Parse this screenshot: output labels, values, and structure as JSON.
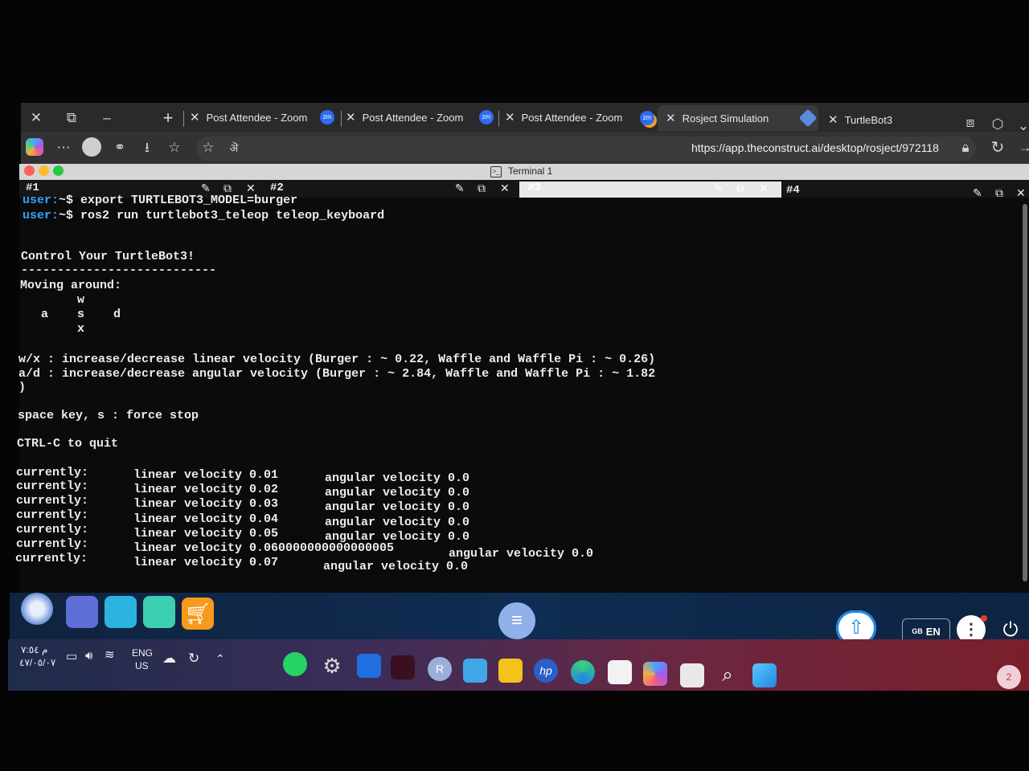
{
  "browser": {
    "tabs": [
      {
        "label": "Post Attendee - Zoom",
        "app_icon": "zm"
      },
      {
        "label": "Post Attendee - Zoom",
        "app_icon": "zm"
      },
      {
        "label": "Post Attendee - Zoom",
        "app_icon": "zm"
      },
      {
        "label": "Rosject Simulation",
        "app_icon": "rosject-icon"
      },
      {
        "label": "TurtleBot3",
        "app_icon": "none"
      }
    ],
    "url": "https://app.theconstruct.ai/desktop/rosject/972118",
    "address_icon_text": "ऄ"
  },
  "terminal": {
    "window_title": "Terminal 1",
    "panes": [
      "#1",
      "#2",
      "#3",
      "#4"
    ],
    "lines": [
      {
        "user": "user:",
        "path": "~$",
        "cmd": " export TURTLEBOT3_MODEL=burger"
      },
      {
        "user": "user:",
        "path": "~$",
        "cmd": " ros2 run turtlebot3_teleop teleop_keyboard"
      }
    ],
    "output": {
      "heading": "Control Your TurtleBot3!",
      "rule": "---------------------------",
      "moving": "Moving around:",
      "key_w": "w",
      "key_row": "a    s    d",
      "key_x": "x",
      "help1": "w/x : increase/decrease linear velocity (Burger : ~ 0.22, Waffle and Waffle Pi : ~ 0.26)",
      "help2": "a/d : increase/decrease angular velocity (Burger : ~ 2.84, Waffle and Waffle Pi : ~ 1.82",
      "help2b": ")",
      "stop": "space key, s : force stop",
      "quit": "CTRL-C to quit"
    },
    "status_rows": [
      {
        "label": "currently:",
        "linear": "linear velocity 0.01",
        "angular": "angular velocity 0.0"
      },
      {
        "label": "currently:",
        "linear": "linear velocity 0.02",
        "angular": "angular velocity 0.0"
      },
      {
        "label": "currently:",
        "linear": "linear velocity 0.03",
        "angular": "angular velocity 0.0"
      },
      {
        "label": "currently:",
        "linear": "linear velocity 0.04",
        "angular": "angular velocity 0.0"
      },
      {
        "label": "currently:",
        "linear": "linear velocity 0.05",
        "angular": "angular velocity 0.0"
      },
      {
        "label": "currently:",
        "linear": "linear velocity 0.060000000000000005",
        "angular": "angular velocity 0.0"
      },
      {
        "label": "currently:",
        "linear": "linear velocity 0.07",
        "angular": "angular velocity 0.0"
      }
    ]
  },
  "dock": {
    "lang_badge": "GB",
    "lang": "EN"
  },
  "taskbar": {
    "time_line1": "م ۷:٥٤",
    "time_line2": "٤۷/٠٥/٠٧",
    "keyboard_line1": "ENG",
    "keyboard_line2": "US",
    "notification_count": "2",
    "avatar_letter": "R"
  },
  "colors": {
    "prompt": "#3aa0ff",
    "terminal_bg": "#0b0b0c",
    "accent": "#1e88e5"
  }
}
